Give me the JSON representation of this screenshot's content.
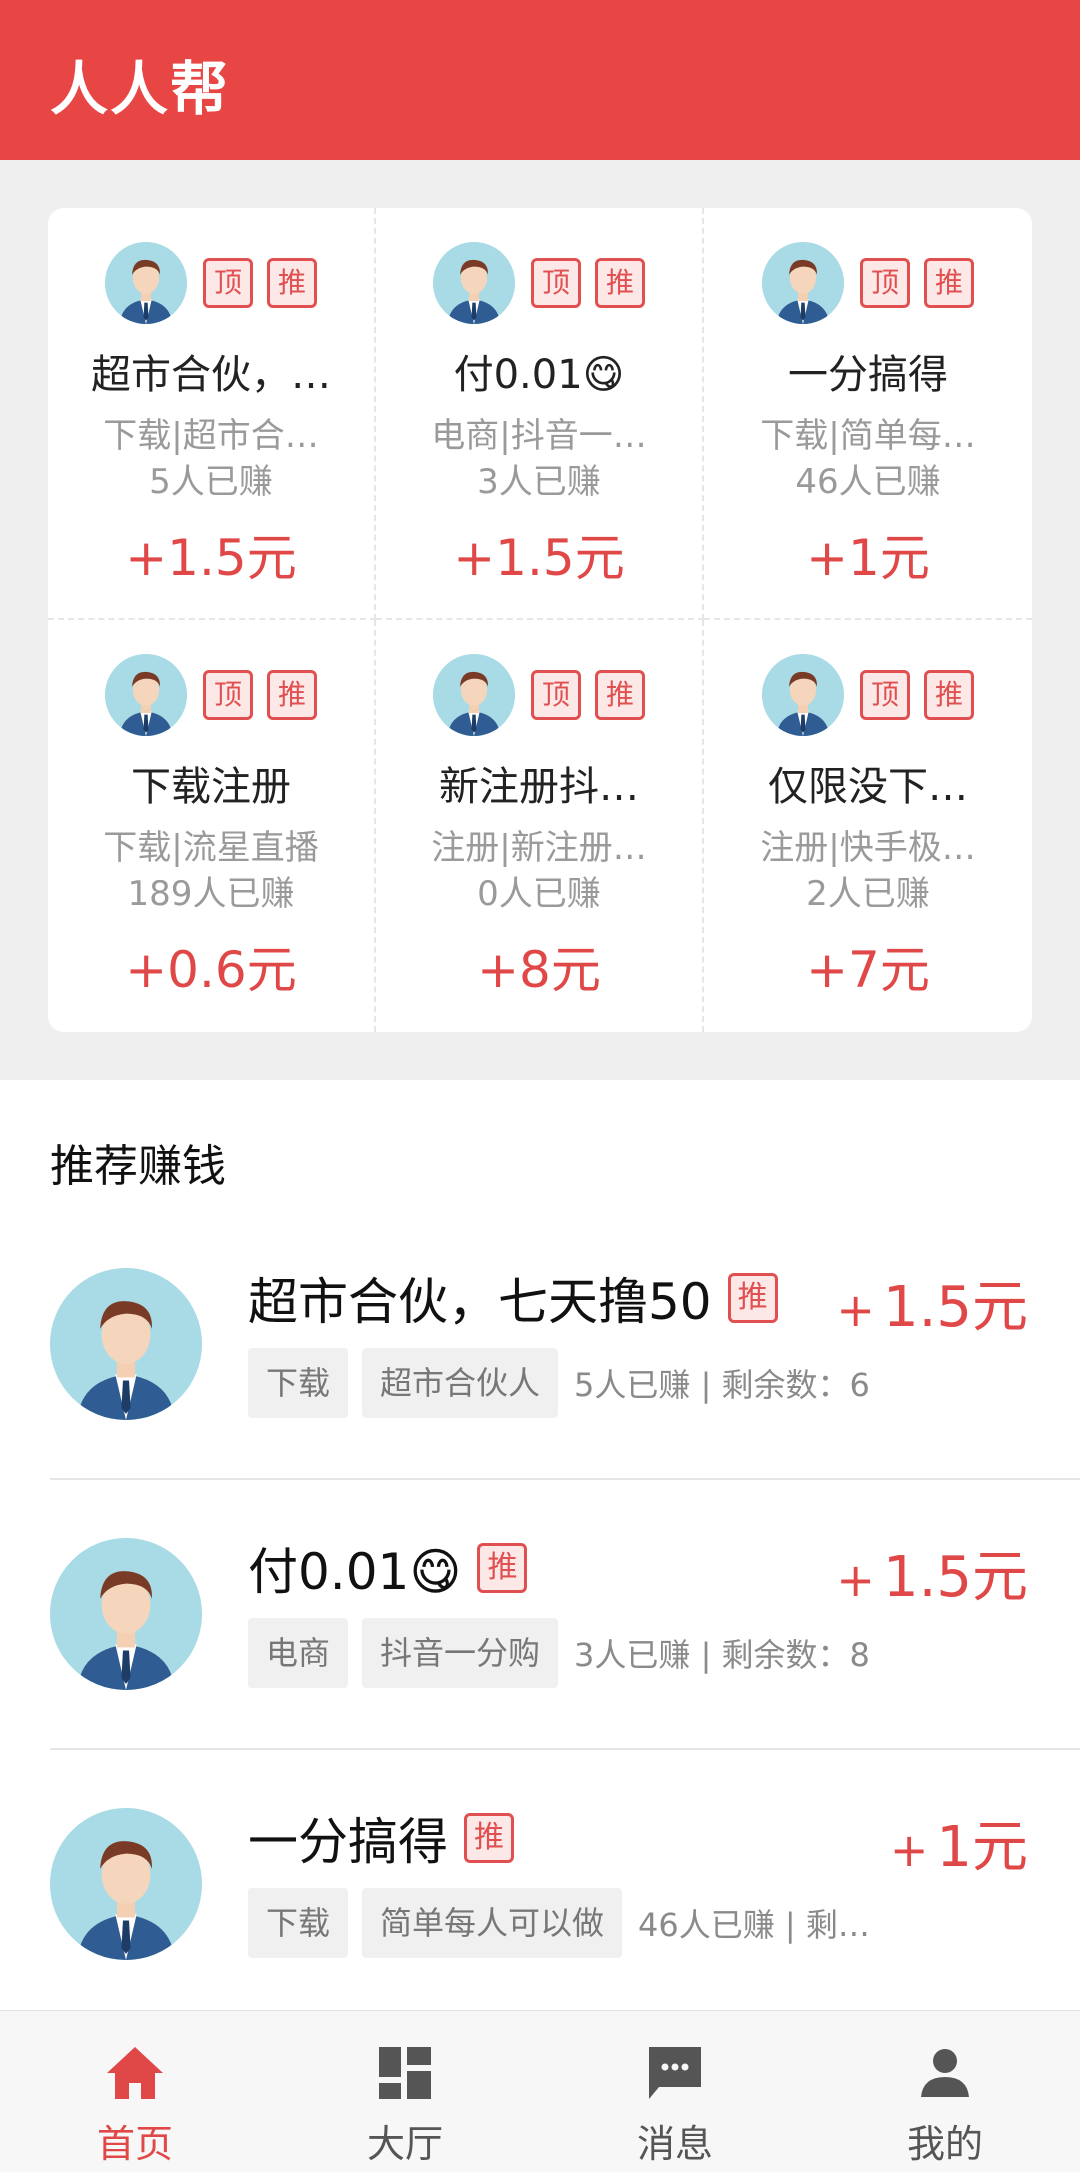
{
  "app": {
    "title": "人人帮"
  },
  "colors": {
    "brand": "#e84545",
    "reward": "#e04848",
    "tag_border": "#e05050"
  },
  "grid": {
    "tag_top": "顶",
    "tag_rec": "推",
    "items": [
      {
        "title": "超市合伙，…",
        "subtitle": "下载|超市合…",
        "earned": "5人已赚",
        "reward": "+1.5元"
      },
      {
        "title": "付0.01😋",
        "subtitle": "电商|抖音一…",
        "earned": "3人已赚",
        "reward": "+1.5元"
      },
      {
        "title": "一分搞得",
        "subtitle": "下载|简单每…",
        "earned": "46人已赚",
        "reward": "+1元"
      },
      {
        "title": "下载注册",
        "subtitle": "下载|流星直播",
        "earned": "189人已赚",
        "reward": "+0.6元"
      },
      {
        "title": "新注册抖…",
        "subtitle": "注册|新注册…",
        "earned": "0人已赚",
        "reward": "+8元"
      },
      {
        "title": "仅限没下…",
        "subtitle": "注册|快手极…",
        "earned": "2人已赚",
        "reward": "+7元"
      }
    ]
  },
  "recommend": {
    "title": "推荐赚钱",
    "tag_rec": "推",
    "plus": "+",
    "items": [
      {
        "title": "超市合伙，七天撸50",
        "reward": "1.5元",
        "chip1": "下载",
        "chip2": "超市合伙人",
        "stats": "5人已赚 | 剩余数：6"
      },
      {
        "title": "付0.01😋",
        "reward": "1.5元",
        "chip1": "电商",
        "chip2": "抖音一分购",
        "stats": "3人已赚 | 剩余数：8"
      },
      {
        "title": "一分搞得",
        "reward": "1元",
        "chip1": "下载",
        "chip2": "简单每人可以做",
        "stats": "46人已赚 | 剩…"
      }
    ]
  },
  "tabs": [
    {
      "label": "首页",
      "icon": "home-icon",
      "active": true
    },
    {
      "label": "大厅",
      "icon": "dashboard-icon",
      "active": false
    },
    {
      "label": "消息",
      "icon": "message-icon",
      "active": false
    },
    {
      "label": "我的",
      "icon": "person-icon",
      "active": false
    }
  ]
}
